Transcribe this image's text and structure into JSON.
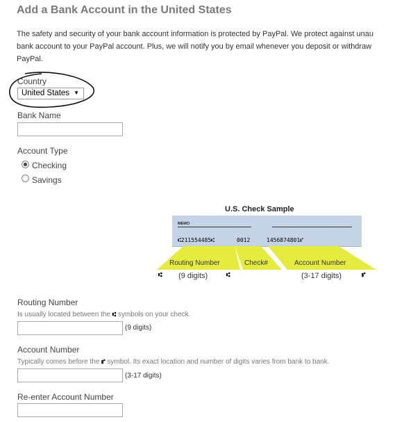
{
  "page": {
    "title": "Add a Bank Account in the United States",
    "intro_lines": [
      "The safety and security of your bank account information is protected by PayPal. We protect against unau",
      "bank account to your PayPal account. Plus, we will notify you by email whenever you deposit or withdraw",
      "PayPal."
    ]
  },
  "country": {
    "label": "Country",
    "value": "United States"
  },
  "bank_name": {
    "label": "Bank Name",
    "value": ""
  },
  "account_type": {
    "label": "Account Type",
    "options": [
      {
        "label": "Checking",
        "selected": true
      },
      {
        "label": "Savings",
        "selected": false
      }
    ]
  },
  "check_sample": {
    "title": "U.S. Check Sample",
    "memo": "MEMO",
    "micr": {
      "routing": "⑆211554485⑆",
      "check": "0012",
      "account": "1456874801⑈"
    },
    "callouts": {
      "routing": "Routing Number",
      "check": "Check#",
      "account": "Account Number"
    },
    "routing_digits": "(9 digits)",
    "account_digits": "(3-17 digits)",
    "colors": {
      "check_bg": "#c5d3e6",
      "callout": "#e6ec3e"
    }
  },
  "routing_number": {
    "label": "Routing Number",
    "hint_before": "Is usually located between the",
    "hint_after": "symbols on your check.",
    "suffix": "(9 digits)",
    "value": ""
  },
  "account_number": {
    "label": "Account Number",
    "hint_before": "Typically comes before the",
    "hint_after": "symbol. Its exact location and number of digits varies from bank to bank.",
    "suffix": "(3-17 digits)",
    "value": ""
  },
  "reenter_account": {
    "label": "Re-enter Account Number",
    "value": ""
  }
}
